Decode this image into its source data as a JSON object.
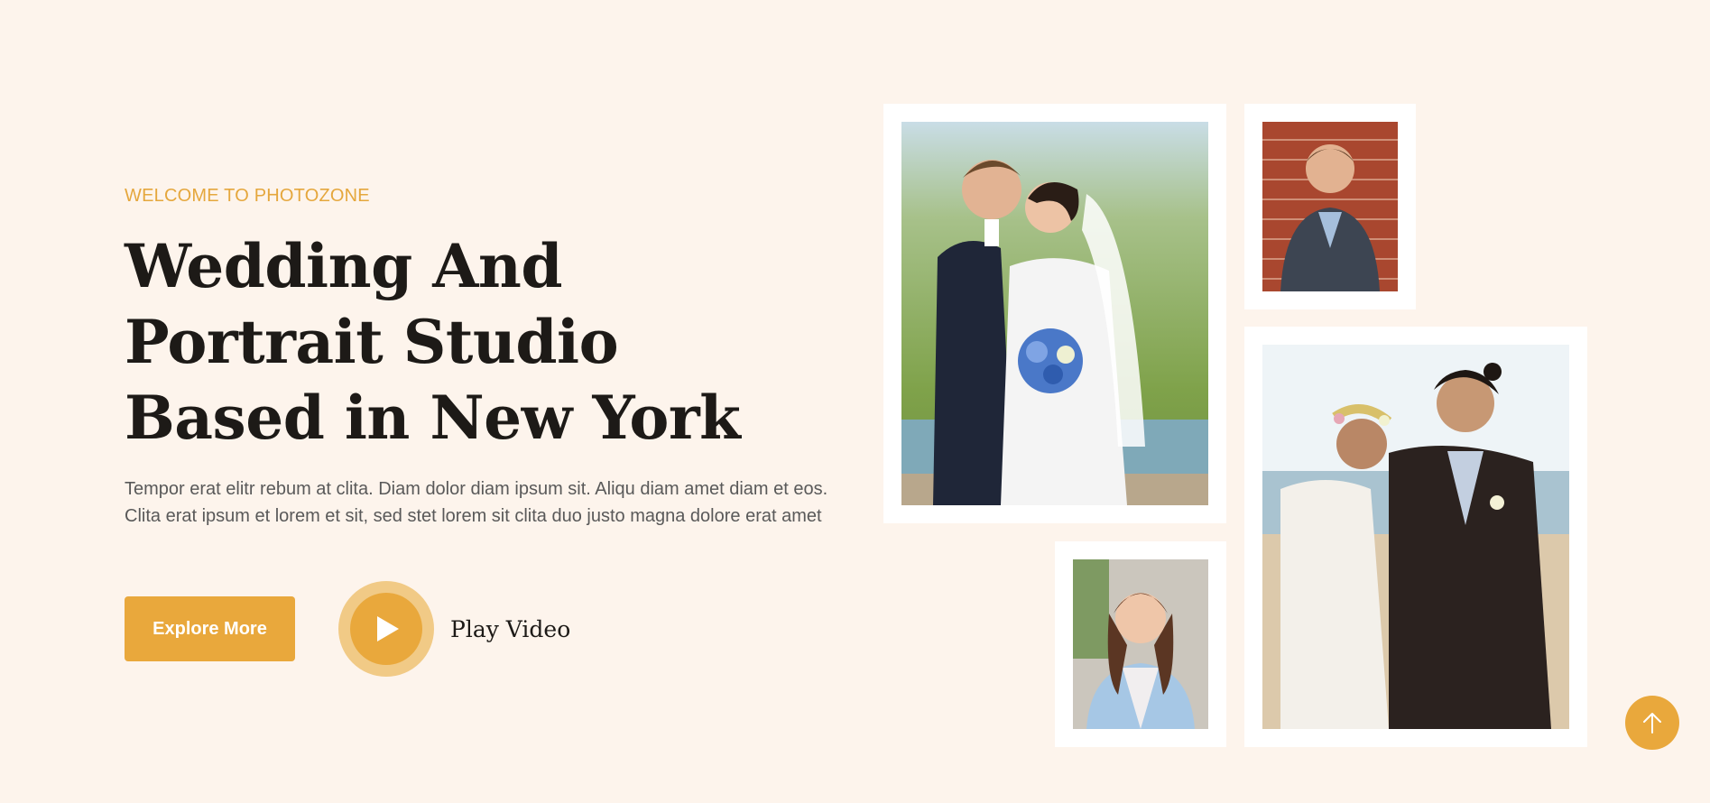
{
  "hero": {
    "eyebrow": "WELCOME TO PHOTOZONE",
    "title": "Wedding And Portrait Studio Based in New York",
    "description": "Tempor erat elitr rebum at clita. Diam dolor diam ipsum sit. Aliqu diam amet diam et eos. Clita erat ipsum et lorem et sit, sed stet lorem sit clita duo justo magna dolore erat amet"
  },
  "actions": {
    "explore_label": "Explore More",
    "play_label": "Play Video"
  },
  "icons": {
    "play": "play-icon",
    "scroll_top": "arrow-up-icon"
  },
  "colors": {
    "accent": "#e9a83c",
    "accent_light": "#f1ca86",
    "background": "#fdf4ec",
    "heading": "#1d1a17",
    "body_text": "#595959"
  }
}
